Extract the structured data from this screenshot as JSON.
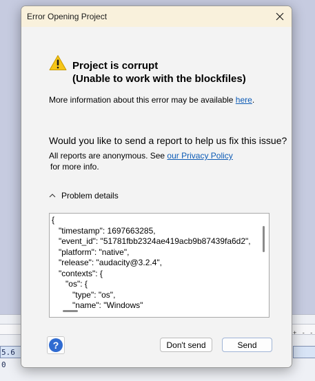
{
  "background": {
    "timecode_fragment": "5.6 0",
    "ruler_ticks": "+ - -"
  },
  "dialog": {
    "title": "Error Opening Project",
    "heading_line1": "Project is corrupt",
    "heading_line2": "(Unable to work with the blockfiles)",
    "info_prefix": "More information about this error may be available ",
    "info_link": "here",
    "info_suffix": ".",
    "question": "Would you like to send a report to help us fix this issue?",
    "anon_prefix": "All reports are anonymous. See ",
    "anon_link": "our Privacy Policy",
    "anon_suffix": "for more info.",
    "details_label": "Problem details",
    "details_text": "{\n   \"timestamp\": 1697663285,\n   \"event_id\": \"51781fbb2324ae419acb9b87439fa6d2\",\n   \"platform\": \"native\",\n   \"release\": \"audacity@3.2.4\",\n   \"contexts\": {\n      \"os\": {\n         \"type\": \"os\",\n         \"name\": \"Windows\"",
    "help_label": "?",
    "dont_send_label": "Don't send",
    "send_label": "Send"
  },
  "colors": {
    "titlebar": "#f9f1dc",
    "link": "#0b5ab5",
    "warning": "#f5c518",
    "help": "#2f6bd1"
  }
}
